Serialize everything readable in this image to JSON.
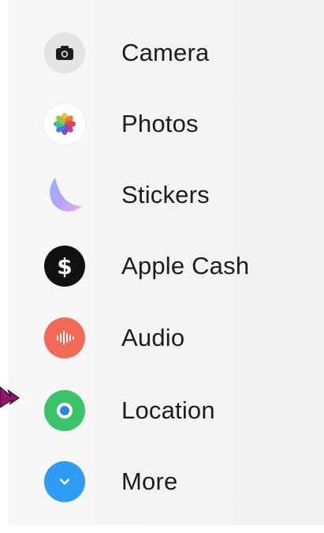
{
  "menu": {
    "items": [
      {
        "label": "Camera",
        "icon": "camera-icon",
        "color": "#e3e3e6"
      },
      {
        "label": "Photos",
        "icon": "photos-icon",
        "color": "#ffffff"
      },
      {
        "label": "Stickers",
        "icon": "stickers-icon",
        "color": "#b9a6f2"
      },
      {
        "label": "Apple Cash",
        "icon": "apple-cash-icon",
        "color": "#111111"
      },
      {
        "label": "Audio",
        "icon": "audio-icon",
        "color": "#f16a55"
      },
      {
        "label": "Location",
        "icon": "location-icon",
        "color": "#3cc46b"
      },
      {
        "label": "More",
        "icon": "chevron-down-icon",
        "color": "#2f9cf3"
      }
    ]
  },
  "pointer": {
    "icon": "arrow-pointer-icon",
    "color": "#8b1a6b"
  }
}
